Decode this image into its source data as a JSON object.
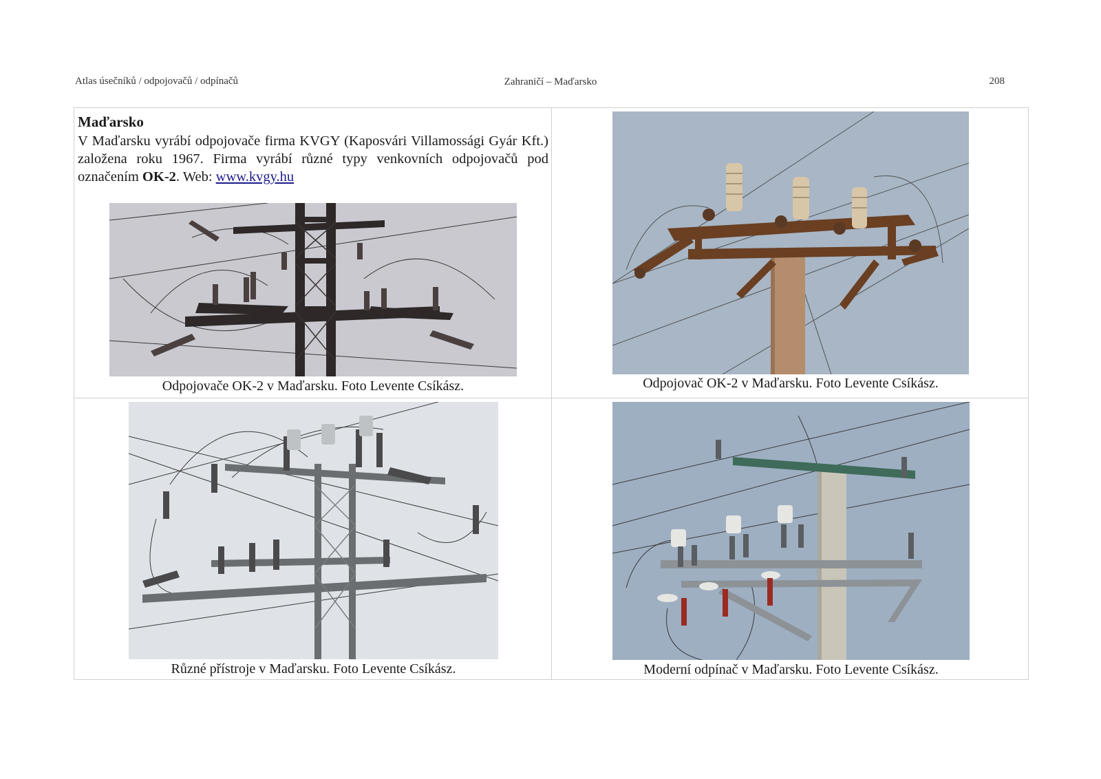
{
  "header": {
    "left": "Atlas úsečníků / odpojovačů / odpínačů",
    "center": "Zahraničí – Maďarsko",
    "page_number": "208"
  },
  "intro": {
    "title": "Maďarsko",
    "text_before": "V Maďarsku vyrábí odpojovače firma KVGY (Kaposvári Villamossági Gyár Kft.) založena roku 1967. Firma vyrábí různé typy venkovních odpojovačů pod označením ",
    "bold": "OK-2",
    "text_middle": ". Web: ",
    "link": "www.kvgy.hu"
  },
  "captions": {
    "top_left": "Odpojovače OK-2 v Maďarsku. Foto Levente Csíkász.",
    "top_right": "Odpojovač OK-2 v Maďarsku. Foto Levente Csíkász.",
    "bottom_left": "Různé přístroje v Maďarsku. Foto Levente Csíkász.",
    "bottom_right": "Moderní odpínač v Maďarsku. Foto Levente Csíkász."
  },
  "colors": {
    "sky_grey": "#c9c9cf",
    "sky_blue": "#a8b6c6",
    "sky_light": "#dfe3e8",
    "sky_steel": "#9eafc2",
    "rust": "#6a3f22",
    "dark_steel": "#2c2a2a",
    "galvanized": "#6b6e70",
    "concrete": "#b48d6c",
    "link": "#1a1a8c"
  }
}
